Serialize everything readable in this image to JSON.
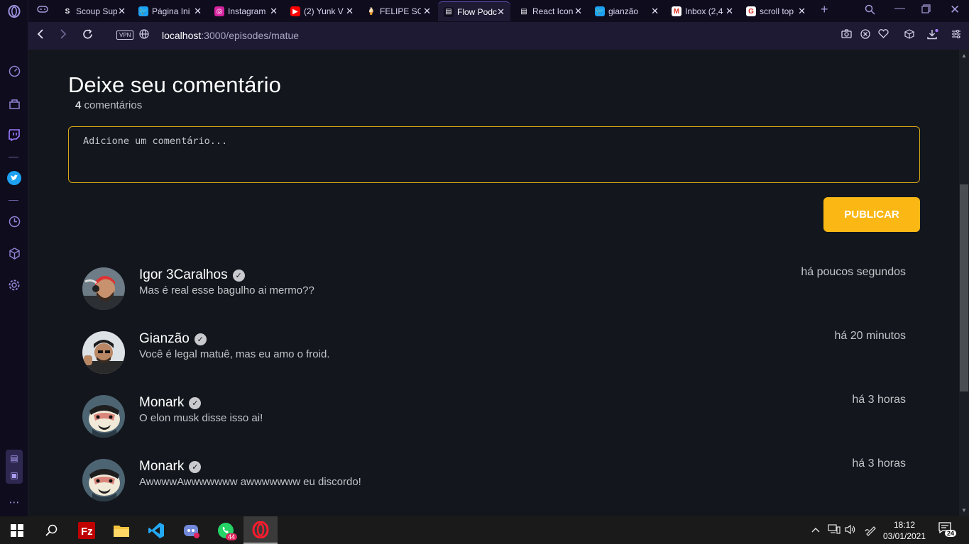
{
  "browser": {
    "tabs": [
      {
        "title": "Scoup Sup",
        "fav": "S",
        "favcolor": "#0f0c1e"
      },
      {
        "title": "Página Ini",
        "fav": "🐦",
        "favcolor": "#1da1f2"
      },
      {
        "title": "Instagram",
        "fav": "◎",
        "favcolor": "#d6249f"
      },
      {
        "title": "(2) Yunk V",
        "fav": "▶",
        "favcolor": "#ff0000"
      },
      {
        "title": "FELIPE SO",
        "fav": "🍦",
        "favcolor": "#0f0c1e"
      },
      {
        "title": "Flow Podc",
        "fav": "▤",
        "favcolor": "#0f0c1e"
      },
      {
        "title": "React Icon",
        "fav": "▤",
        "favcolor": "#0f0c1e"
      },
      {
        "title": "gianzão",
        "fav": "🐦",
        "favcolor": "#1da1f2"
      },
      {
        "title": "Inbox (2,4",
        "fav": "M",
        "favcolor": "#ffffff"
      },
      {
        "title": "scroll top",
        "fav": "G",
        "favcolor": "#ffffff"
      }
    ],
    "active_tab": 5,
    "vpn_label": "VPN",
    "url_host": "localhost",
    "url_path": ":3000/episodes/matue"
  },
  "comments_section": {
    "heading": "Deixe seu comentário",
    "count_number": "4",
    "count_label": " comentários",
    "placeholder": "Adicione um comentário...",
    "publish_label": "PUBLICAR"
  },
  "comments": [
    {
      "name": "Igor 3Caralhos",
      "text": "Mas é real esse bagulho ai mermo??",
      "time": "há poucos segundos",
      "avatar": "igor"
    },
    {
      "name": "Gianzão",
      "text": "Você é legal matuê, mas eu amo o froid.",
      "time": "há 20 minutos",
      "avatar": "gian"
    },
    {
      "name": "Monark",
      "text": "O elon musk disse isso ai!",
      "time": "há 3 horas",
      "avatar": "monark"
    },
    {
      "name": "Monark",
      "text": "AwwwwAwwwwwww awwwwwww eu discordo!",
      "time": "há 3 horas",
      "avatar": "monark"
    }
  ],
  "taskbar": {
    "whatsapp_badge": "44",
    "time": "18:12",
    "date": "03/01/2021",
    "notifications": "24"
  }
}
